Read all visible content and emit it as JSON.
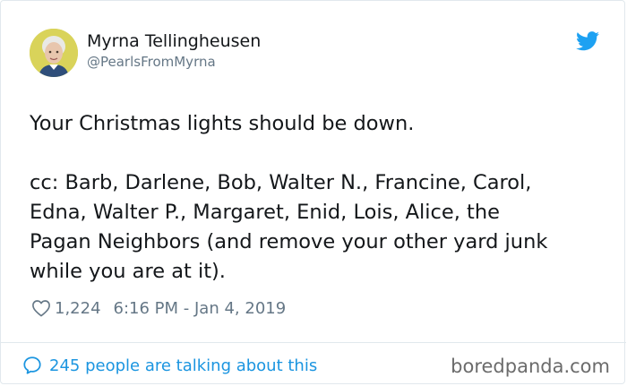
{
  "tweet": {
    "author_name": "Myrna Tellingheusen",
    "handle": "@PearlsFromMyrna",
    "lines": [
      "Your Christmas lights should be down.",
      "",
      "cc: Barb, Darlene, Bob, Walter N., Francine, Carol,",
      "Edna, Walter P., Margaret, Enid, Lois, Alice, the",
      "Pagan Neighbors (and remove your other yard junk",
      "while you are at it)."
    ],
    "likes": "1,224",
    "timestamp": "6:16 PM - Jan 4, 2019",
    "talking": "245 people are talking about this"
  },
  "watermark": "boredpanda.com",
  "icons": {
    "twitter": "twitter-bird-icon",
    "like": "heart-icon",
    "reply": "speech-bubble-icon"
  },
  "colors": {
    "twitter_blue": "#1da1f2",
    "link_blue": "#1b95e0",
    "secondary_text": "#657786",
    "border": "#e1e8ed"
  }
}
